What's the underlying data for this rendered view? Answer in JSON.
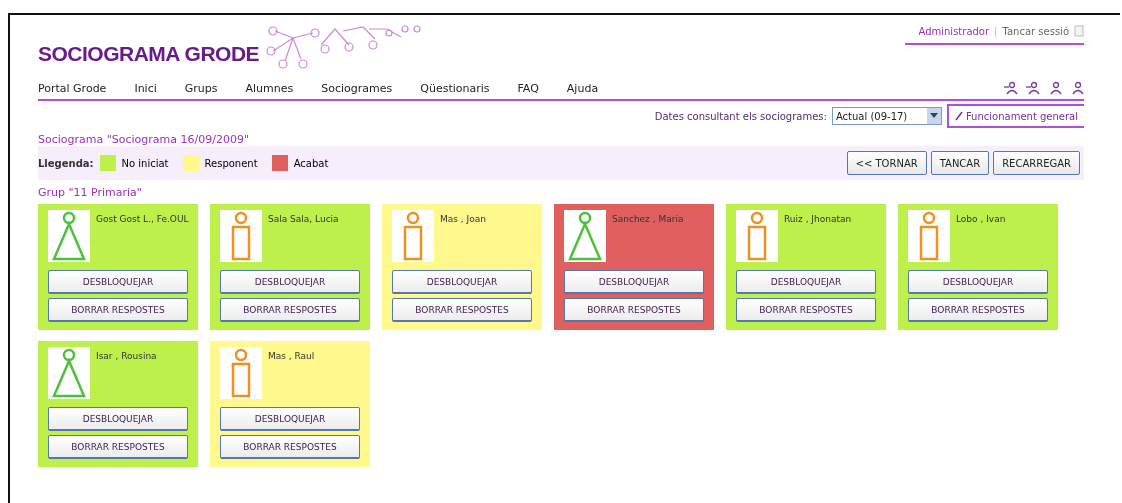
{
  "header": {
    "logo": "SOCIOGRAMA GRODE",
    "user": "Administrador",
    "separator": "|",
    "logout": "Tancar sessió"
  },
  "nav": [
    "Portal Grode",
    "Inici",
    "Grups",
    "Alumnes",
    "Sociogrames",
    "Qüestionaris",
    "FAQ",
    "Ajuda"
  ],
  "filter": {
    "label": "Dates consultant els sociogrames:",
    "value": "Actual (09-17)",
    "help_button": "Funcionament general"
  },
  "title": "Sociograma \"Sociograma 16/09/2009\"",
  "legend": {
    "label": "Llegenda:",
    "items": [
      {
        "label": "No iniciat",
        "color": "#bef04c"
      },
      {
        "label": "Responent",
        "color": "#fff88c"
      },
      {
        "label": "Acabat",
        "color": "#e06060"
      }
    ]
  },
  "actions": [
    "<< TORNAR",
    "TANCAR",
    "RECARREGAR"
  ],
  "group": "Grup \"11 Primaria\"",
  "students": [
    {
      "name": "Gost Gost L., Fe.OUL",
      "kind": "not_started",
      "figure": {
        "kind": "female"
      },
      "buttons": [
        "DESBLOQUEJAR",
        "BORRAR RESPOSTES"
      ]
    },
    {
      "name": "Sala Sala, Lucia",
      "kind": "not_started",
      "figure": {
        "kind": "male"
      },
      "buttons": [
        "DESBLOQUEJAR",
        "BORRAR RESPOSTES"
      ]
    },
    {
      "name": "Mas , Joan",
      "kind": "answering",
      "figure": {
        "kind": "male"
      },
      "buttons": [
        "DESBLOQUEJAR",
        "BORRAR RESPOSTES"
      ]
    },
    {
      "name": "Sanchez , Maria",
      "kind": "finished",
      "figure": {
        "kind": "female"
      },
      "buttons": [
        "DESBLOQUEJAR",
        "BORRAR RESPOSTES"
      ]
    },
    {
      "name": "Ruiz , Jhonatan",
      "kind": "not_started",
      "figure": {
        "kind": "male"
      },
      "buttons": [
        "DESBLOQUEJAR",
        "BORRAR RESPOSTES"
      ]
    },
    {
      "name": "Lobo , Ivan",
      "kind": "not_started",
      "figure": {
        "kind": "male"
      },
      "buttons": [
        "DESBLOQUEJAR",
        "BORRAR RESPOSTES"
      ]
    },
    {
      "name": "Isar , Rousina",
      "kind": "not_started",
      "figure": {
        "kind": "female"
      },
      "buttons": [
        "DESBLOQUEJAR",
        "BORRAR RESPOSTES"
      ]
    },
    {
      "name": "Mas , Raul",
      "kind": "answering",
      "figure": {
        "kind": "male"
      },
      "buttons": [
        "DESBLOQUEJAR",
        "BORRAR RESPOSTES"
      ]
    }
  ]
}
